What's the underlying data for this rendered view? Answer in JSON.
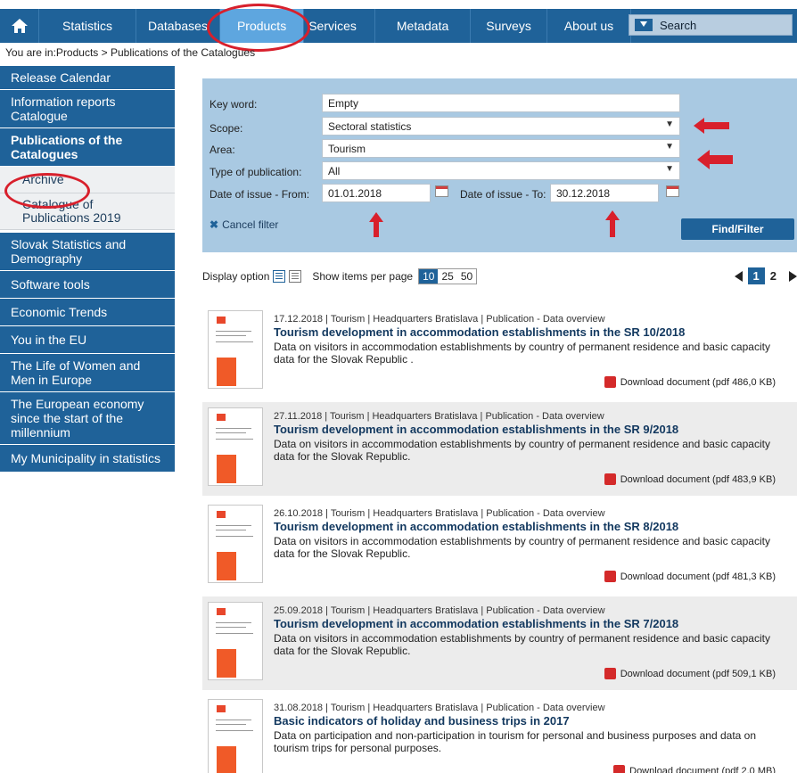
{
  "nav": {
    "items": [
      "Statistics",
      "Databases",
      "Products",
      "Services",
      "Metadata",
      "Surveys",
      "About us"
    ],
    "active": "Products",
    "search_label": "Search"
  },
  "breadcrumb": "You are in:Products > Publications of the Catalogues",
  "sidebar": {
    "items": [
      {
        "label": "Release Calendar"
      },
      {
        "label": "Information reports Catalogue"
      },
      {
        "label": "Publications of the Catalogues"
      },
      {
        "label": "Archive"
      },
      {
        "label": "Catalogue of Publications 2019"
      },
      {
        "label": "Slovak Statistics and Demography"
      },
      {
        "label": "Software tools"
      },
      {
        "label": "Economic Trends"
      },
      {
        "label": "You in the EU"
      },
      {
        "label": "The Life of Women and Men in Europe"
      },
      {
        "label": "The European economy since the start of the millennium"
      },
      {
        "label": "My Municipality in statistics"
      }
    ]
  },
  "filter": {
    "keyword_label": "Key word:",
    "keyword_value": "Empty",
    "scope_label": "Scope:",
    "scope_value": "Sectoral statistics",
    "area_label": "Area:",
    "area_value": "Tourism",
    "type_label": "Type of publication:",
    "type_value": "All",
    "from_label": "Date of issue - From:",
    "from_value": "01.01.2018",
    "to_label": "Date of issue - To:",
    "to_value": "30.12.2018",
    "cancel_label": "Cancel filter",
    "find_label": "Find/Filter"
  },
  "display": {
    "option_label": "Display option",
    "per_page_label": "Show items per page",
    "per_page_options": [
      "10",
      "25",
      "50"
    ],
    "pages": [
      "1",
      "2"
    ]
  },
  "results": [
    {
      "meta": "17.12.2018 | Tourism | Headquarters Bratislava | Publication - Data overview",
      "title": "Tourism development in accommodation establishments in the SR 10/2018",
      "desc": "Data on visitors in accommodation establishments by country of permanent residence and basic capacity data for the Slovak Republic .",
      "download": "Download document (pdf 486,0 KB)"
    },
    {
      "meta": "27.11.2018 | Tourism | Headquarters Bratislava | Publication - Data overview",
      "title": "Tourism development in accommodation establishments in the SR 9/2018",
      "desc": "Data on visitors in accommodation establishments by country of permanent residence and basic capacity data for the Slovak Republic.",
      "download": "Download document (pdf 483,9 KB)"
    },
    {
      "meta": "26.10.2018 | Tourism | Headquarters Bratislava | Publication - Data overview",
      "title": "Tourism development in accommodation establishments in the SR 8/2018",
      "desc": "Data on visitors in accommodation establishments by country of permanent residence and basic capacity data for the Slovak Republic.",
      "download": "Download document (pdf 481,3 KB)"
    },
    {
      "meta": "25.09.2018 | Tourism | Headquarters Bratislava | Publication - Data overview",
      "title": "Tourism development in accommodation establishments in the SR 7/2018",
      "desc": "Data on visitors in accommodation establishments by country of permanent residence and basic capacity data for the Slovak Republic.",
      "download": "Download document (pdf 509,1 KB)"
    },
    {
      "meta": "31.08.2018 | Tourism | Headquarters Bratislava | Publication - Data overview",
      "title": "Basic indicators of holiday and business trips in 2017",
      "desc": "Data on participation and non-participation in tourism for personal and business purposes and data on tourism trips for personal purposes.",
      "download": "Download document (pdf 2,0 MB)"
    }
  ],
  "colors": {
    "nav_blue": "#1f6299",
    "active_tab": "#5ea6df",
    "filter_bg": "#a9c9e2",
    "annotation_red": "#d8202c"
  }
}
